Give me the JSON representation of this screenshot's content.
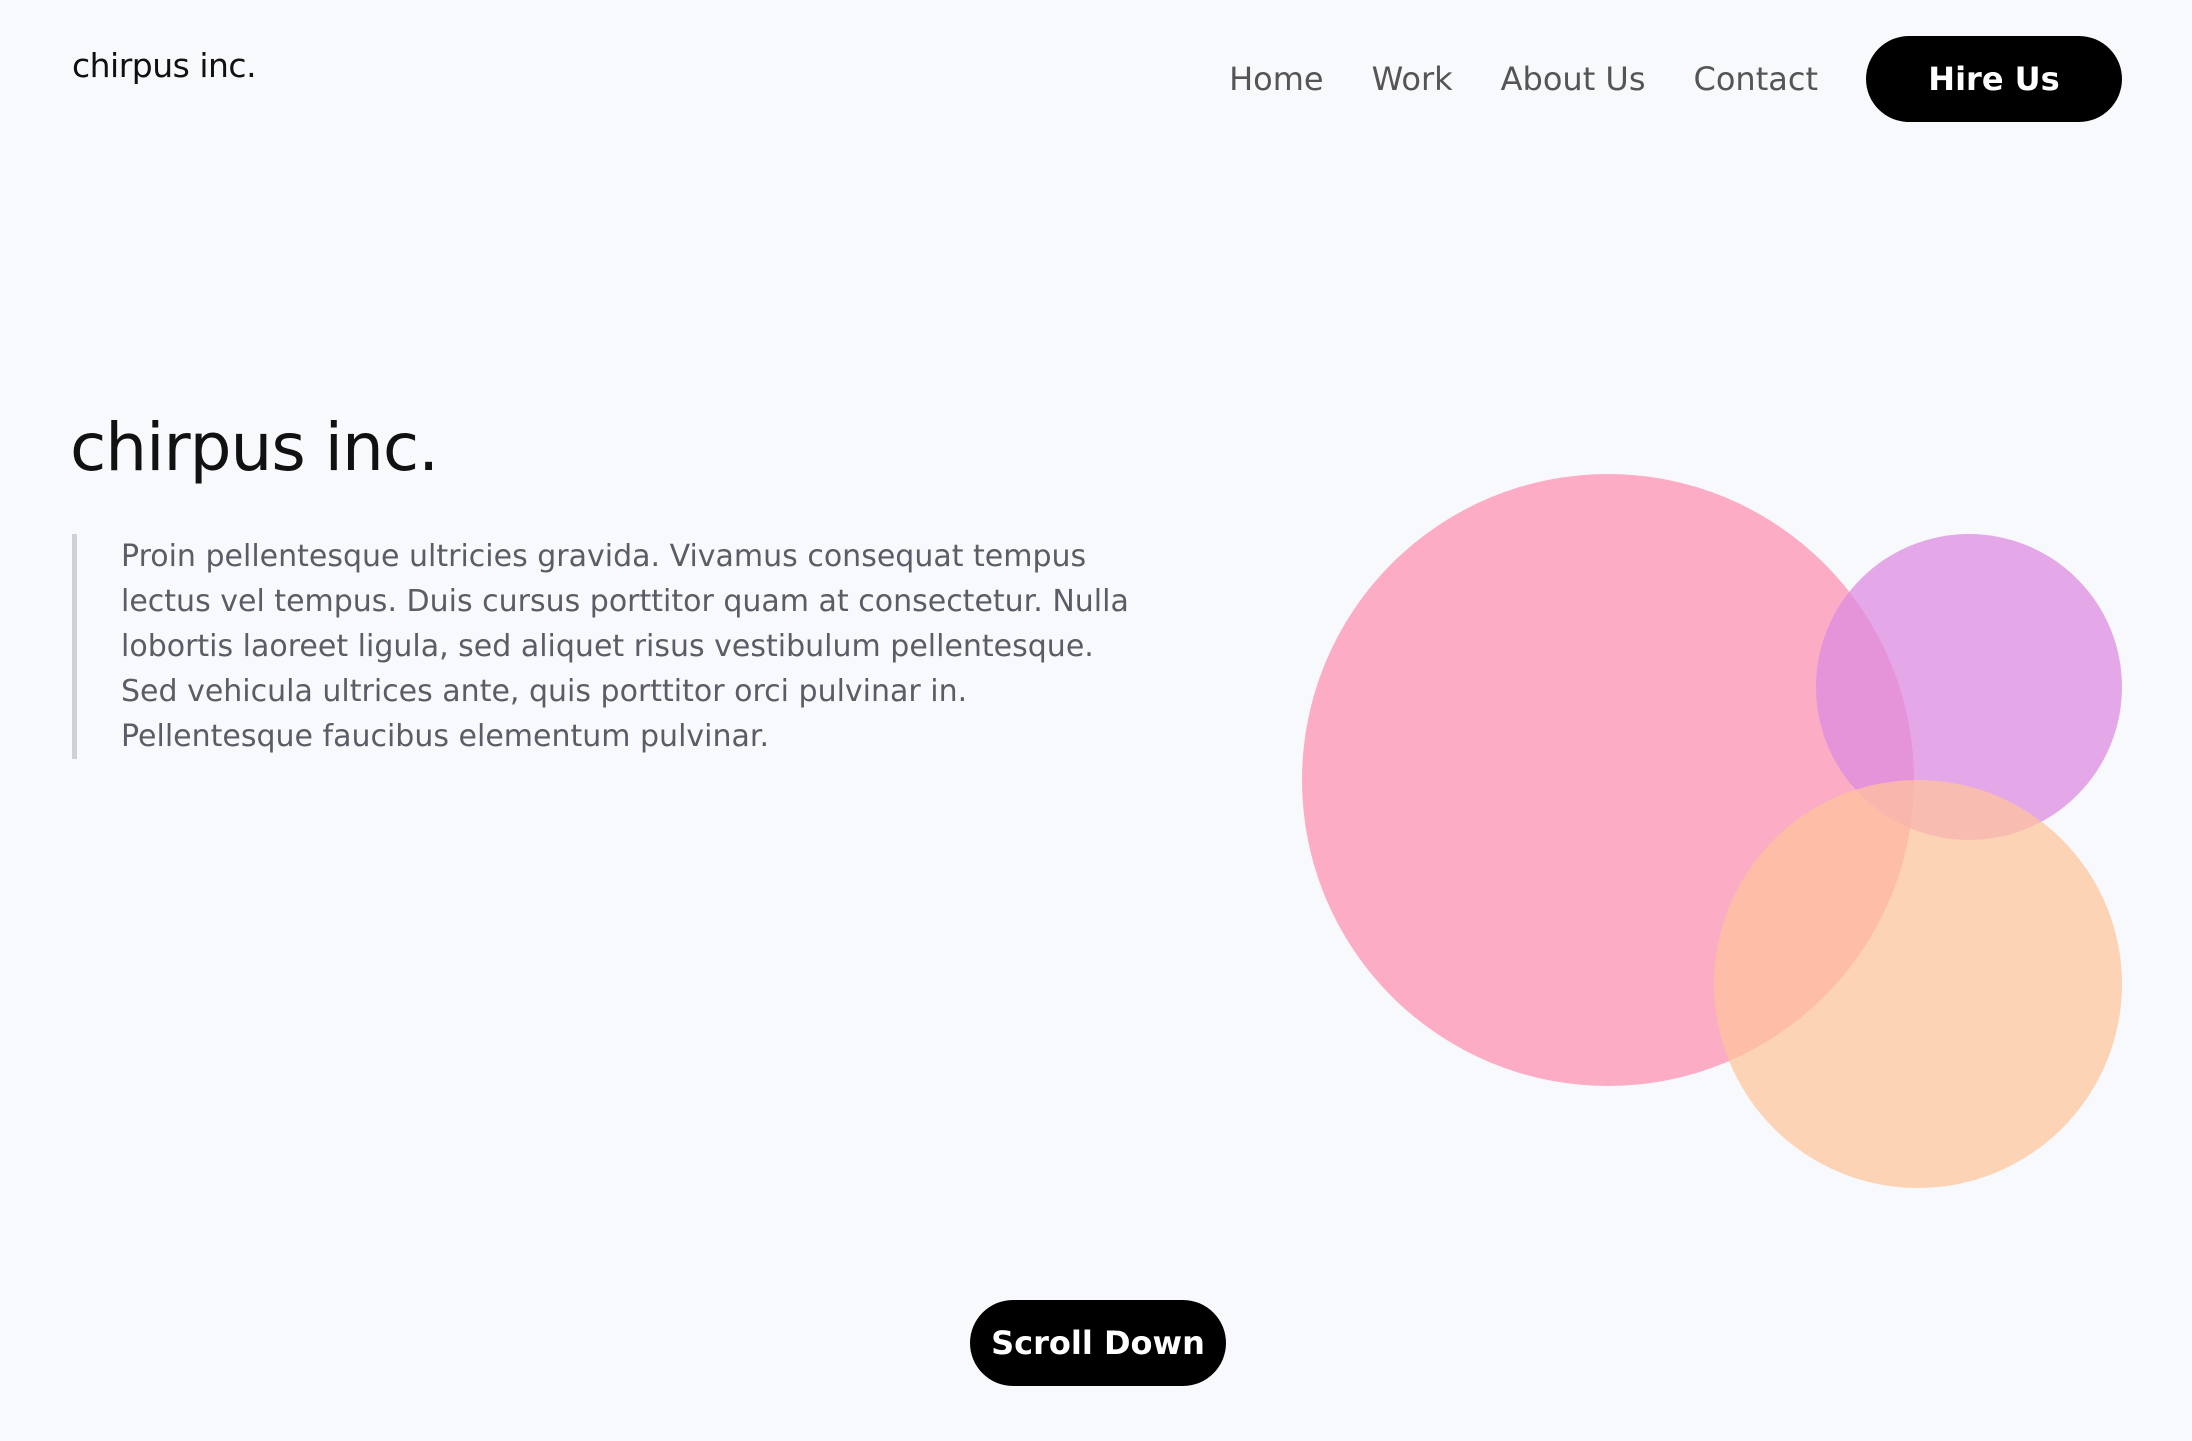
{
  "header": {
    "logo": "chirpus inc.",
    "nav": {
      "home": "Home",
      "work": "Work",
      "about": "About Us",
      "contact": "Contact"
    },
    "cta_label": "Hire Us"
  },
  "hero": {
    "title": "chirpus inc.",
    "quote": "Proin pellentesque ultricies gravida. Vivamus consequat tempus lectus vel tempus. Duis cursus porttitor quam at consectetur. Nulla lobortis laoreet ligula, sed aliquet risus vestibulum pellentesque. Sed vehicula ultrices ante, quis porttitor orci pulvinar in. Pellentesque faucibus elementum pulvinar.",
    "scroll_label": "Scroll Down"
  },
  "colors": {
    "background": "#f8f9fc",
    "button": "#000000",
    "circle_pink": "#fd96b4",
    "circle_purple": "#de8ce1",
    "circle_peach": "#ffc49b"
  }
}
